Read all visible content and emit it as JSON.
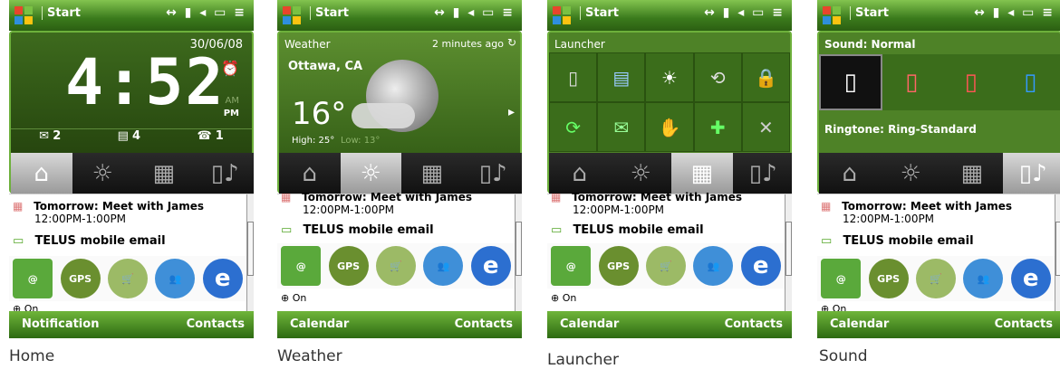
{
  "common": {
    "start_label": "Start",
    "status_icons": "↔ ▮ ◂ ▭ ≡",
    "tab_icons": [
      "⌂",
      "☼",
      "▦",
      "▯♪"
    ],
    "list": {
      "event_title": "Tomorrow: Meet with James",
      "event_time": "12:00PM-1:00PM",
      "email": "TELUS mobile email",
      "gps_label": "GPS",
      "on_label": "On"
    },
    "right_soft": "Contacts"
  },
  "home": {
    "caption": "Home",
    "date": "30/06/08",
    "time": "4:52",
    "ampm_top": "AM",
    "ampm_bottom": "PM",
    "counts": [
      "2",
      "4",
      "1"
    ],
    "left_soft": "Notification"
  },
  "weather": {
    "caption": "Weather",
    "title": "Weather",
    "updated": "2 minutes ago",
    "city": "Ottawa, CA",
    "temp": "16°",
    "high": "High: 25°",
    "low": "Low: 13°",
    "left_soft": "Calendar"
  },
  "launcher": {
    "caption": "Launcher",
    "title": "Launcher",
    "left_soft": "Calendar"
  },
  "sound": {
    "caption": "Sound",
    "title": "Sound: Normal",
    "ringtone": "Ringtone: Ring-Standard",
    "left_soft": "Calendar"
  }
}
